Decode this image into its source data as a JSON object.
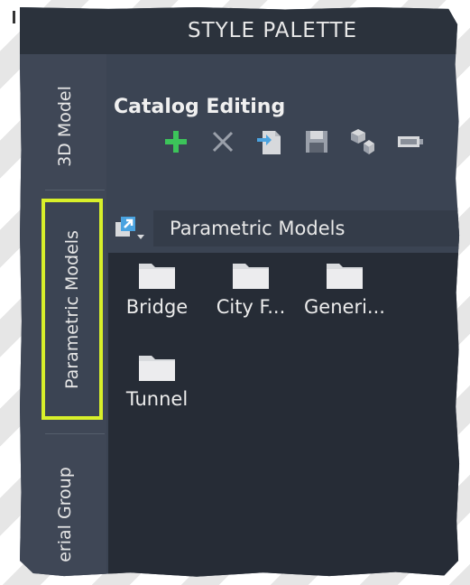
{
  "window": {
    "title": "STYLE PALETTE"
  },
  "sidebar": {
    "tabs": [
      {
        "label": "3D Model"
      },
      {
        "label": "Parametric Models",
        "selected": true
      },
      {
        "label": "erial Group"
      }
    ]
  },
  "catalog": {
    "title": "Catalog Editing",
    "toolbar": {
      "icons": [
        "add-icon",
        "delete-icon",
        "import-icon",
        "save-icon",
        "copy-icon",
        "more-icon"
      ]
    }
  },
  "path": {
    "value": "Parametric Models"
  },
  "folders": [
    {
      "label": "Bridge"
    },
    {
      "label": "City F..."
    },
    {
      "label": "Generi..."
    },
    {
      "label": "Tunnel"
    }
  ],
  "colors": {
    "highlight": "#d8f02a",
    "add_green": "#3cc45a",
    "panel_bg": "#3b4453",
    "content_bg": "#262c36"
  }
}
